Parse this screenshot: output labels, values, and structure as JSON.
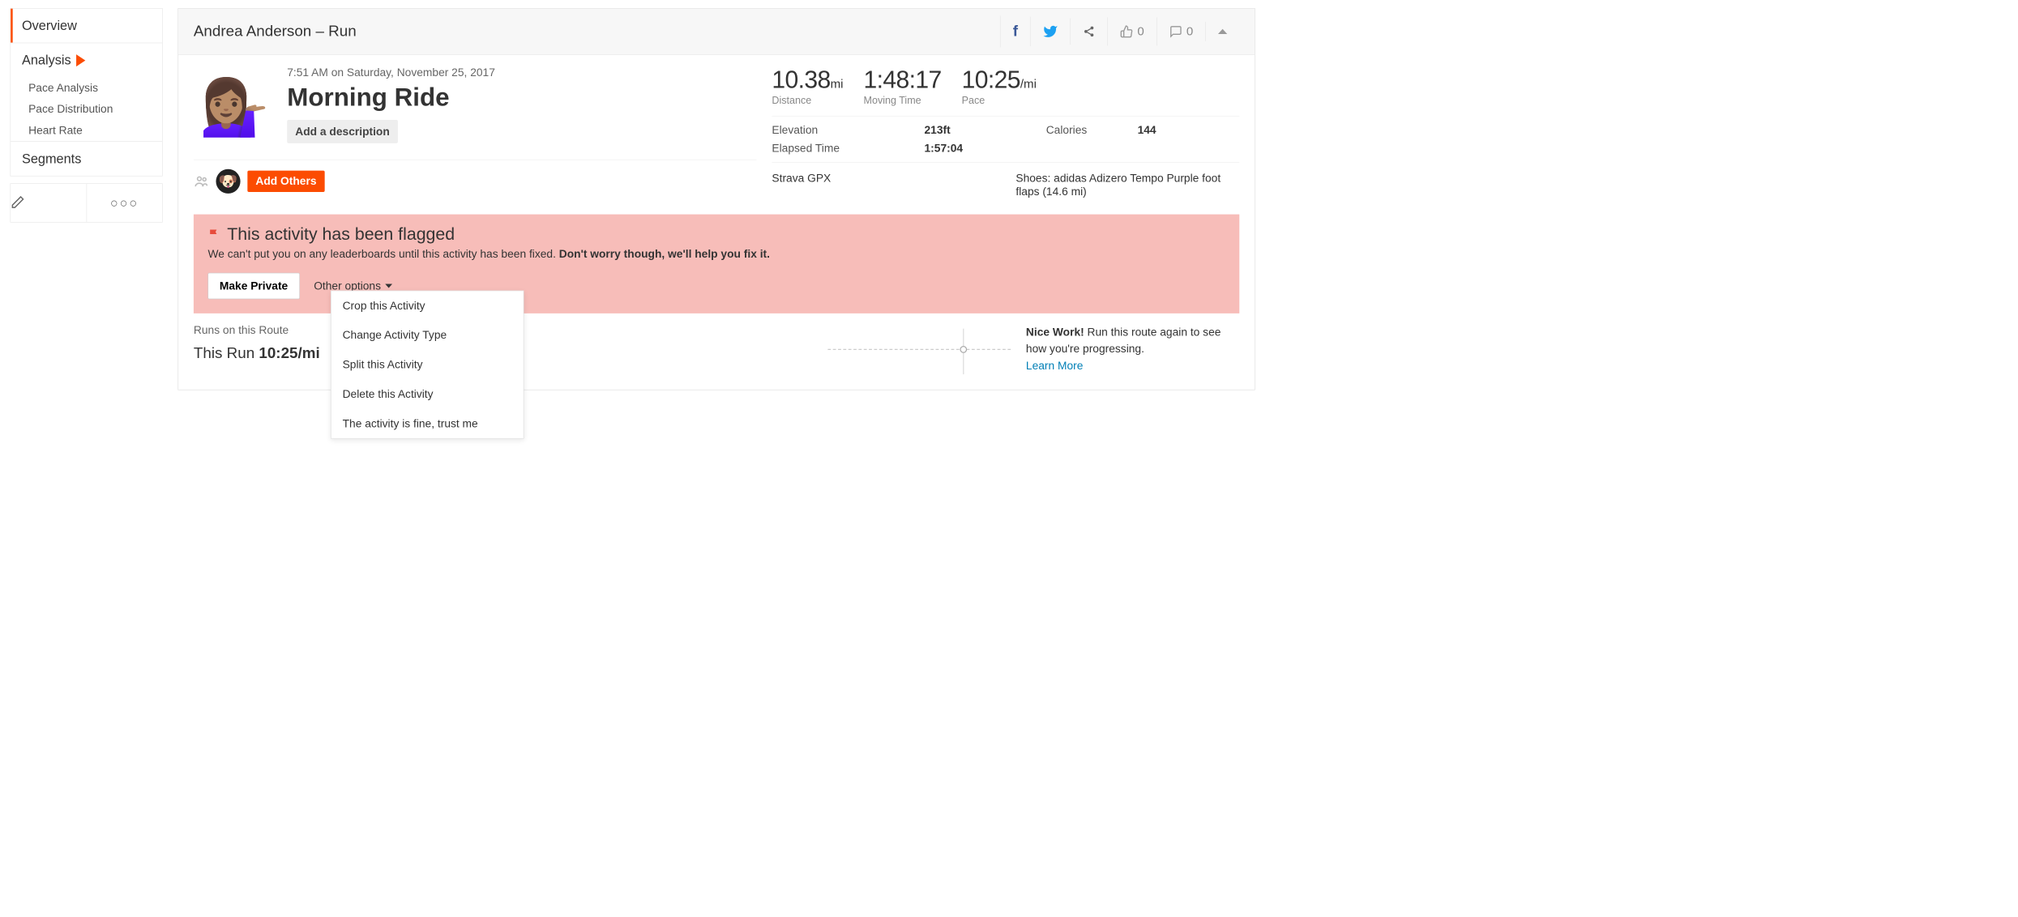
{
  "sidebar": {
    "overview": "Overview",
    "analysis": "Analysis",
    "analysis_items": [
      "Pace Analysis",
      "Pace Distribution",
      "Heart Rate"
    ],
    "segments": "Segments"
  },
  "header": {
    "breadcrumb": "Andrea Anderson – Run",
    "kudos_count": "0",
    "comment_count": "0"
  },
  "activity": {
    "timestamp": "7:51 AM on Saturday, November 25, 2017",
    "title": "Morning Ride",
    "add_description": "Add a description",
    "add_others": "Add Others"
  },
  "stats": {
    "distance_val": "10.38",
    "distance_unit": "mi",
    "distance_lbl": "Distance",
    "moving_val": "1:48:17",
    "moving_lbl": "Moving Time",
    "pace_val": "10:25",
    "pace_unit": "/mi",
    "pace_lbl": "Pace"
  },
  "details": {
    "elevation_lbl": "Elevation",
    "elevation_val": "213ft",
    "calories_lbl": "Calories",
    "calories_val": "144",
    "elapsed_lbl": "Elapsed Time",
    "elapsed_val": "1:57:04"
  },
  "meta": {
    "device": "Strava GPX",
    "shoes": "Shoes: adidas Adizero Tempo Purple foot flaps (14.6 mi)"
  },
  "flag": {
    "title": "This activity has been flagged",
    "body_plain": "We can't put you on any leaderboards until this activity has been fixed. ",
    "body_bold": "Don't worry though, we'll help you fix it.",
    "make_private": "Make Private",
    "other_options": "Other options",
    "menu": [
      "Crop this Activity",
      "Change Activity Type",
      "Split this Activity",
      "Delete this Activity",
      "The activity is fine, trust me"
    ]
  },
  "route": {
    "label": "Runs on this Route",
    "this_run_prefix": "This Run ",
    "this_run_val": "10:25/mi",
    "nice_bold": "Nice Work! ",
    "nice_text": "Run this route again to see how you're progressing.",
    "learn_more": "Learn More"
  }
}
